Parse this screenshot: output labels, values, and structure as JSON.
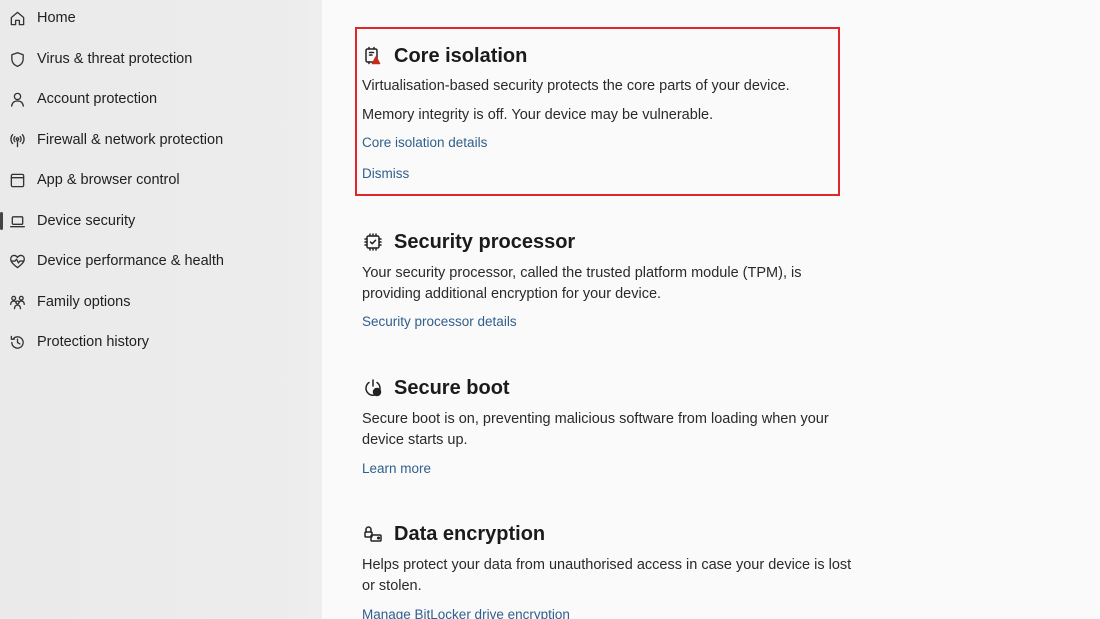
{
  "sidebar": {
    "items": [
      {
        "label": "Home",
        "icon": "home-icon"
      },
      {
        "label": "Virus & threat protection",
        "icon": "shield-icon"
      },
      {
        "label": "Account protection",
        "icon": "person-icon"
      },
      {
        "label": "Firewall & network protection",
        "icon": "wifi-antenna-icon"
      },
      {
        "label": "App & browser control",
        "icon": "browser-window-icon"
      },
      {
        "label": "Device security",
        "icon": "laptop-icon"
      },
      {
        "label": "Device performance & health",
        "icon": "heart-pulse-icon"
      },
      {
        "label": "Family options",
        "icon": "family-icon"
      },
      {
        "label": "Protection history",
        "icon": "history-icon"
      }
    ],
    "active_index": 5
  },
  "sections": {
    "core_isolation": {
      "title": "Core isolation",
      "icon": "core-isolation-chip-warning-icon",
      "line1": "Virtualisation-based security protects the core parts of your device.",
      "line2": "Memory integrity is off. Your device may be vulnerable.",
      "details_link": "Core isolation details",
      "dismiss_link": "Dismiss",
      "highlight_color": "#e0252b"
    },
    "security_processor": {
      "title": "Security processor",
      "icon": "processor-chip-icon",
      "desc": "Your security processor, called the trusted platform module (TPM), is providing additional encryption for your device.",
      "details_link": "Security processor details"
    },
    "secure_boot": {
      "title": "Secure boot",
      "icon": "power-check-icon",
      "desc": "Secure boot is on, preventing malicious software from loading when your device starts up.",
      "learn_more_link": "Learn more"
    },
    "data_encryption": {
      "title": "Data encryption",
      "icon": "lock-drive-icon",
      "desc": "Helps protect your data from unauthorised access in case your device is lost or stolen.",
      "manage_link": "Manage BitLocker drive encryption"
    }
  },
  "colors": {
    "link": "#2f5f8c",
    "sidebar_bg": "#ebebeb",
    "main_bg": "#fafafa"
  }
}
